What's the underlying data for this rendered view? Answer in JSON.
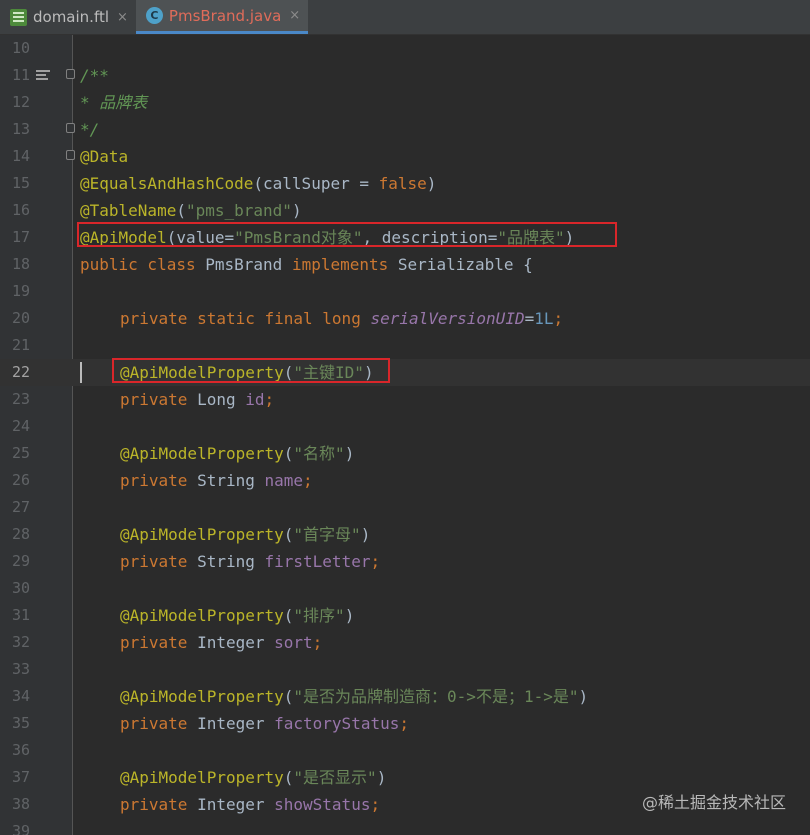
{
  "tabs": [
    {
      "label": "domain.ftl",
      "icon": "ftl-file-icon",
      "active": false,
      "close": "×"
    },
    {
      "label": "PmsBrand.java",
      "icon": "java-class-icon",
      "icon_letter": "C",
      "active": true,
      "close": "×"
    }
  ],
  "lines": [
    {
      "n": "10",
      "tokens": []
    },
    {
      "n": "11",
      "tokens": [
        {
          "t": "/**",
          "c": "cmt"
        }
      ]
    },
    {
      "n": "12",
      "tokens": [
        {
          "t": "* 品牌表",
          "c": "cmt"
        }
      ]
    },
    {
      "n": "13",
      "tokens": [
        {
          "t": "*/",
          "c": "cmt"
        }
      ]
    },
    {
      "n": "14",
      "tokens": [
        {
          "t": "@Data",
          "c": "ann"
        }
      ]
    },
    {
      "n": "15",
      "tokens": [
        {
          "t": "@EqualsAndHashCode",
          "c": "ann"
        },
        {
          "t": "(callSuper = ",
          "c": "pl"
        },
        {
          "t": "false",
          "c": "kw"
        },
        {
          "t": ")",
          "c": "pl"
        }
      ]
    },
    {
      "n": "16",
      "tokens": [
        {
          "t": "@TableName",
          "c": "ann"
        },
        {
          "t": "(",
          "c": "pl"
        },
        {
          "t": "\"pms_brand\"",
          "c": "str"
        },
        {
          "t": ")",
          "c": "pl"
        }
      ]
    },
    {
      "n": "17",
      "tokens": [
        {
          "t": "@ApiModel",
          "c": "ann"
        },
        {
          "t": "(value=",
          "c": "pl"
        },
        {
          "t": "\"PmsBrand对象\"",
          "c": "str"
        },
        {
          "t": ", description=",
          "c": "pl"
        },
        {
          "t": "\"品牌表\"",
          "c": "str"
        },
        {
          "t": ")",
          "c": "pl"
        }
      ]
    },
    {
      "n": "18",
      "tokens": [
        {
          "t": "public class ",
          "c": "kw"
        },
        {
          "t": "PmsBrand ",
          "c": "pl"
        },
        {
          "t": "implements ",
          "c": "kw"
        },
        {
          "t": "Serializable {",
          "c": "pl"
        }
      ]
    },
    {
      "n": "19",
      "tokens": []
    },
    {
      "n": "20",
      "indent": true,
      "tokens": [
        {
          "t": "private static final long ",
          "c": "kw"
        },
        {
          "t": "serialVersionUID",
          "c": "sfld"
        },
        {
          "t": "=",
          "c": "pl"
        },
        {
          "t": "1L",
          "c": "num"
        },
        {
          "t": ";",
          "c": "kw"
        }
      ]
    },
    {
      "n": "21",
      "tokens": []
    },
    {
      "n": "22",
      "indent": true,
      "current": true,
      "tokens": [
        {
          "t": "@ApiModelProperty",
          "c": "ann"
        },
        {
          "t": "(",
          "c": "pl"
        },
        {
          "t": "\"主键ID\"",
          "c": "str"
        },
        {
          "t": ")",
          "c": "pl"
        }
      ]
    },
    {
      "n": "23",
      "indent": true,
      "tokens": [
        {
          "t": "private ",
          "c": "kw"
        },
        {
          "t": "Long ",
          "c": "pl"
        },
        {
          "t": "id",
          "c": "fld"
        },
        {
          "t": ";",
          "c": "kw"
        }
      ]
    },
    {
      "n": "24",
      "tokens": []
    },
    {
      "n": "25",
      "indent": true,
      "tokens": [
        {
          "t": "@ApiModelProperty",
          "c": "ann"
        },
        {
          "t": "(",
          "c": "pl"
        },
        {
          "t": "\"名称\"",
          "c": "str"
        },
        {
          "t": ")",
          "c": "pl"
        }
      ]
    },
    {
      "n": "26",
      "indent": true,
      "tokens": [
        {
          "t": "private ",
          "c": "kw"
        },
        {
          "t": "String ",
          "c": "pl"
        },
        {
          "t": "name",
          "c": "fld"
        },
        {
          "t": ";",
          "c": "kw"
        }
      ]
    },
    {
      "n": "27",
      "tokens": []
    },
    {
      "n": "28",
      "indent": true,
      "tokens": [
        {
          "t": "@ApiModelProperty",
          "c": "ann"
        },
        {
          "t": "(",
          "c": "pl"
        },
        {
          "t": "\"首字母\"",
          "c": "str"
        },
        {
          "t": ")",
          "c": "pl"
        }
      ]
    },
    {
      "n": "29",
      "indent": true,
      "tokens": [
        {
          "t": "private ",
          "c": "kw"
        },
        {
          "t": "String ",
          "c": "pl"
        },
        {
          "t": "firstLetter",
          "c": "fld"
        },
        {
          "t": ";",
          "c": "kw"
        }
      ]
    },
    {
      "n": "30",
      "tokens": []
    },
    {
      "n": "31",
      "indent": true,
      "tokens": [
        {
          "t": "@ApiModelProperty",
          "c": "ann"
        },
        {
          "t": "(",
          "c": "pl"
        },
        {
          "t": "\"排序\"",
          "c": "str"
        },
        {
          "t": ")",
          "c": "pl"
        }
      ]
    },
    {
      "n": "32",
      "indent": true,
      "tokens": [
        {
          "t": "private ",
          "c": "kw"
        },
        {
          "t": "Integer ",
          "c": "pl"
        },
        {
          "t": "sort",
          "c": "fld"
        },
        {
          "t": ";",
          "c": "kw"
        }
      ]
    },
    {
      "n": "33",
      "tokens": []
    },
    {
      "n": "34",
      "indent": true,
      "tokens": [
        {
          "t": "@ApiModelProperty",
          "c": "ann"
        },
        {
          "t": "(",
          "c": "pl"
        },
        {
          "t": "\"是否为品牌制造商：0->不是；1->是\"",
          "c": "str"
        },
        {
          "t": ")",
          "c": "pl"
        }
      ]
    },
    {
      "n": "35",
      "indent": true,
      "tokens": [
        {
          "t": "private ",
          "c": "kw"
        },
        {
          "t": "Integer ",
          "c": "pl"
        },
        {
          "t": "factoryStatus",
          "c": "fld"
        },
        {
          "t": ";",
          "c": "kw"
        }
      ]
    },
    {
      "n": "36",
      "tokens": []
    },
    {
      "n": "37",
      "indent": true,
      "tokens": [
        {
          "t": "@ApiModelProperty",
          "c": "ann"
        },
        {
          "t": "(",
          "c": "pl"
        },
        {
          "t": "\"是否显示\"",
          "c": "str"
        },
        {
          "t": ")",
          "c": "pl"
        }
      ]
    },
    {
      "n": "38",
      "indent": true,
      "tokens": [
        {
          "t": "private ",
          "c": "kw"
        },
        {
          "t": "Integer ",
          "c": "pl"
        },
        {
          "t": "showStatus",
          "c": "fld"
        },
        {
          "t": ";",
          "c": "kw"
        }
      ]
    },
    {
      "n": "39",
      "tokens": []
    }
  ],
  "watermark": "@稀土掘金技术社区",
  "colors": {
    "highlight_box": "#d9262a",
    "keyword": "#cc7832",
    "annotation": "#bbb529",
    "string": "#6a8759",
    "field": "#9876aa"
  }
}
